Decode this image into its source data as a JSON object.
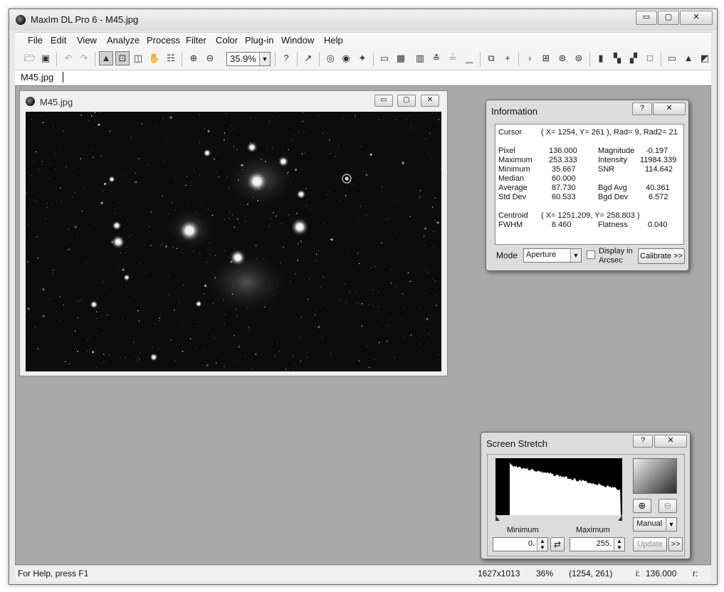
{
  "app": {
    "title": "MaxIm DL Pro 6 - M45.jpg",
    "minimize": "▭",
    "restore": "▢",
    "close": "✕"
  },
  "menu": [
    "File",
    "Edit",
    "View",
    "Analyze",
    "Process",
    "Filter",
    "Color",
    "Plug-in",
    "Window",
    "Help"
  ],
  "toolbar": {
    "zoom": "35.9%"
  },
  "tab": {
    "label": "M45.jpg"
  },
  "image_window": {
    "title": "M45.jpg"
  },
  "info": {
    "title": "Information",
    "help": "?",
    "close": "✕",
    "cursor_label": "Cursor",
    "cursor_value": "( X= 1254, Y=  261 ), Rad=  9, Rad2= 21",
    "rows": [
      {
        "l1": "Pixel",
        "v1": "136.000",
        "l2": "Magnitude",
        "v2": "-0.197"
      },
      {
        "l1": "Maximum",
        "v1": "253.333",
        "l2": "Intensity",
        "v2": "11984.339"
      },
      {
        "l1": "Minimum",
        "v1": "35.667",
        "l2": "SNR",
        "v2": "114.642"
      },
      {
        "l1": "Median",
        "v1": "60.000",
        "l2": "",
        "v2": ""
      },
      {
        "l1": "Average",
        "v1": "87.730",
        "l2": "Bgd Avg",
        "v2": "40.361"
      },
      {
        "l1": "Std Dev",
        "v1": "60.533",
        "l2": "Bgd Dev",
        "v2": "6.572"
      }
    ],
    "centroid_label": "Centroid",
    "centroid_value": "( X= 1251.209, Y=  258.803 )",
    "fwhm_label": "FWHM",
    "fwhm_value": "6.460",
    "flatness_label": "Flatness",
    "flatness_value": "0.040",
    "mode_label": "Mode",
    "mode_value": "Aperture",
    "display_label_1": "Display in",
    "display_label_2": "Arcsec",
    "calibrate": "Calibrate >>"
  },
  "stretch": {
    "title": "Screen Stretch",
    "help": "?",
    "close": "✕",
    "min_label": "Minimum",
    "max_label": "Maximum",
    "min_value": "0.",
    "max_value": "255.",
    "mode": "Manual",
    "update": "Update",
    "more": ">>"
  },
  "status": {
    "help": "For Help, press F1",
    "dims": "1627x1013",
    "zoom": "36%",
    "coords": "(1254, 261)",
    "i_label": "i:",
    "i_value": "136.000",
    "r_label": "r:"
  }
}
